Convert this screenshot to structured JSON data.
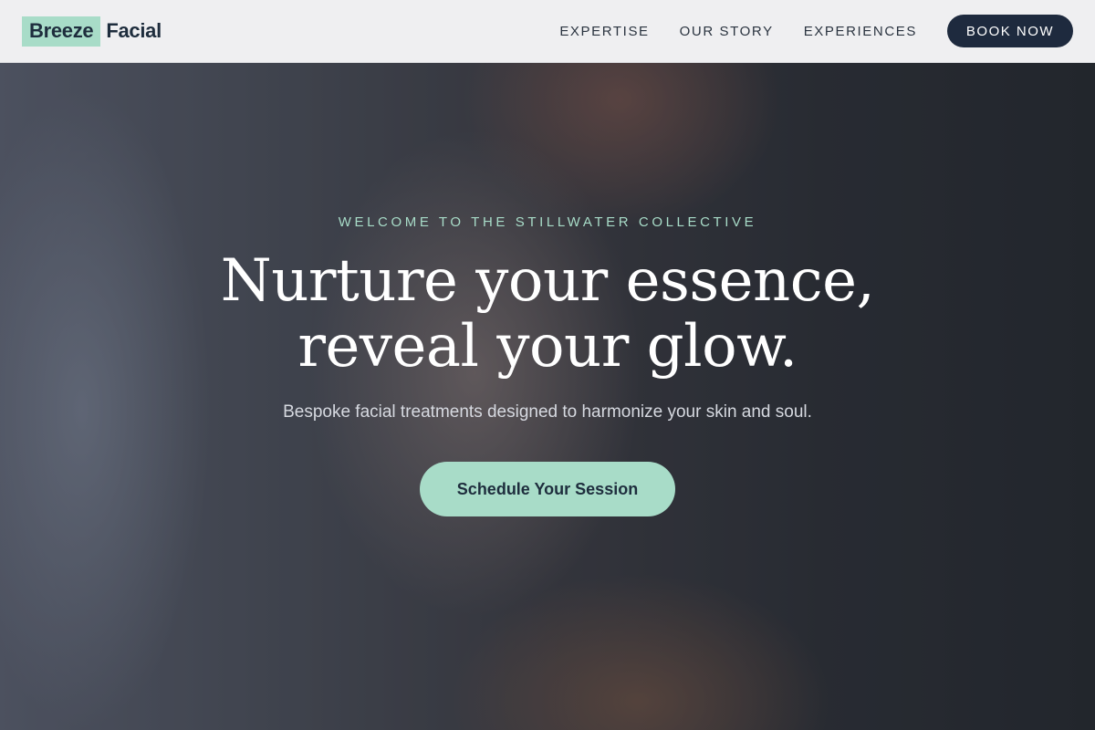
{
  "header": {
    "logo_highlight": "Breeze",
    "logo_rest": "Facial",
    "nav": [
      "EXPERTISE",
      "OUR STORY",
      "EXPERIENCES"
    ],
    "book_label": "BOOK NOW"
  },
  "hero": {
    "eyebrow": "WELCOME TO THE STILLWATER COLLECTIVE",
    "headline_line1": "Nurture your essence,",
    "headline_line2": "reveal your glow.",
    "subhead": "Bespoke facial treatments designed to harmonize your skin and soul.",
    "cta_label": "Schedule Your Session"
  },
  "colors": {
    "accent": "#a8dcc8",
    "navy": "#1e2a3e",
    "header_bg": "#efeff1"
  }
}
